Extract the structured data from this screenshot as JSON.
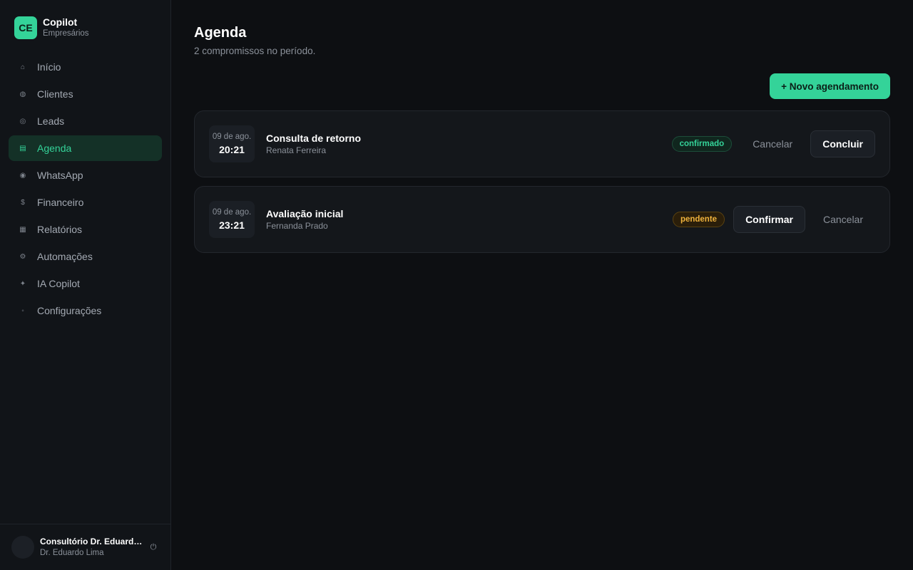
{
  "brand": {
    "logo": "CE",
    "name": "Copilot",
    "subtitle": "Empresários"
  },
  "sidebar": {
    "items": [
      {
        "label": "Início",
        "icon": "home-icon",
        "glyph": "⌂",
        "active": false
      },
      {
        "label": "Clientes",
        "icon": "clients-icon",
        "glyph": "◍",
        "active": false
      },
      {
        "label": "Leads",
        "icon": "target-icon",
        "glyph": "◎",
        "active": false
      },
      {
        "label": "Agenda",
        "icon": "calendar-icon",
        "glyph": "▤",
        "active": true
      },
      {
        "label": "WhatsApp",
        "icon": "chat-icon",
        "glyph": "◉",
        "active": false
      },
      {
        "label": "Financeiro",
        "icon": "dollar-icon",
        "glyph": "$",
        "active": false
      },
      {
        "label": "Relatórios",
        "icon": "report-icon",
        "glyph": "▦",
        "active": false
      },
      {
        "label": "Automações",
        "icon": "gear-icon",
        "glyph": "⚙",
        "active": false
      },
      {
        "label": "IA Copilot",
        "icon": "sparkle-icon",
        "glyph": "✦",
        "active": false
      },
      {
        "label": "Configurações",
        "icon": "settings-icon",
        "glyph": "◦",
        "active": false
      }
    ]
  },
  "user": {
    "name": "Consultório Dr. Eduardo Lima",
    "subtitle": "Dr. Eduardo Lima",
    "logout_icon": "power-icon"
  },
  "main": {
    "title": "Agenda",
    "subtitle": "2 compromissos no período.",
    "new_button": "+ Novo agendamento"
  },
  "appointments": [
    {
      "date": "09 de ago.",
      "time": "20:21",
      "title": "Consulta de retorno",
      "client": "Renata Ferreira",
      "status": "confirmado",
      "status_color": "#34d399",
      "actions": [
        "Cancelar",
        "Concluir"
      ]
    },
    {
      "date": "09 de ago.",
      "time": "23:21",
      "title": "Avaliação inicial",
      "client": "Fernanda Prado",
      "status": "pendente",
      "status_color": "#f0b33c",
      "actions": [
        "Confirmar",
        "Cancelar"
      ]
    }
  ],
  "colors": {
    "accent": "#34d399",
    "background": "#0d0f12",
    "sidebar": "#111418",
    "warning": "#f0b33c"
  }
}
